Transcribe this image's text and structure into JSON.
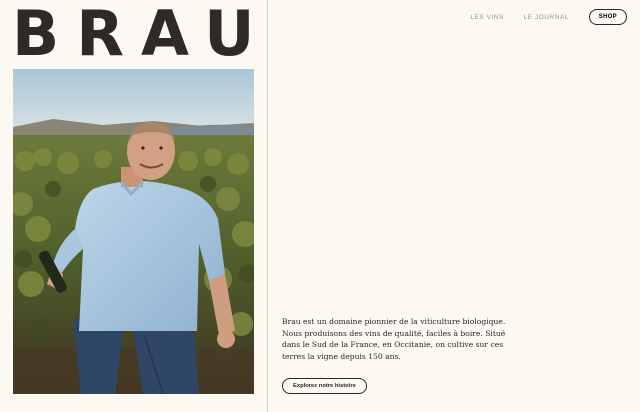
{
  "brand": {
    "logo_text": "BRAU"
  },
  "nav": {
    "items": [
      {
        "label": "LES VINS"
      },
      {
        "label": "LE JOURNAL"
      }
    ],
    "shop_label": "SHOP"
  },
  "intro": {
    "text": "Brau est un domaine pionnier de la viticulture biologique. Nous produisons des vins de qualité, faciles à boire. Situé dans le Sud de la France, en Occitanie, on cultive sur ces terres la vigne depuis 150 ans.",
    "cta_label": "Explorez notre histoire"
  },
  "colors": {
    "background": "#fcf8f2",
    "text": "#2b2724",
    "nav_muted": "#9a948d",
    "divider": "#d9d3cb"
  }
}
